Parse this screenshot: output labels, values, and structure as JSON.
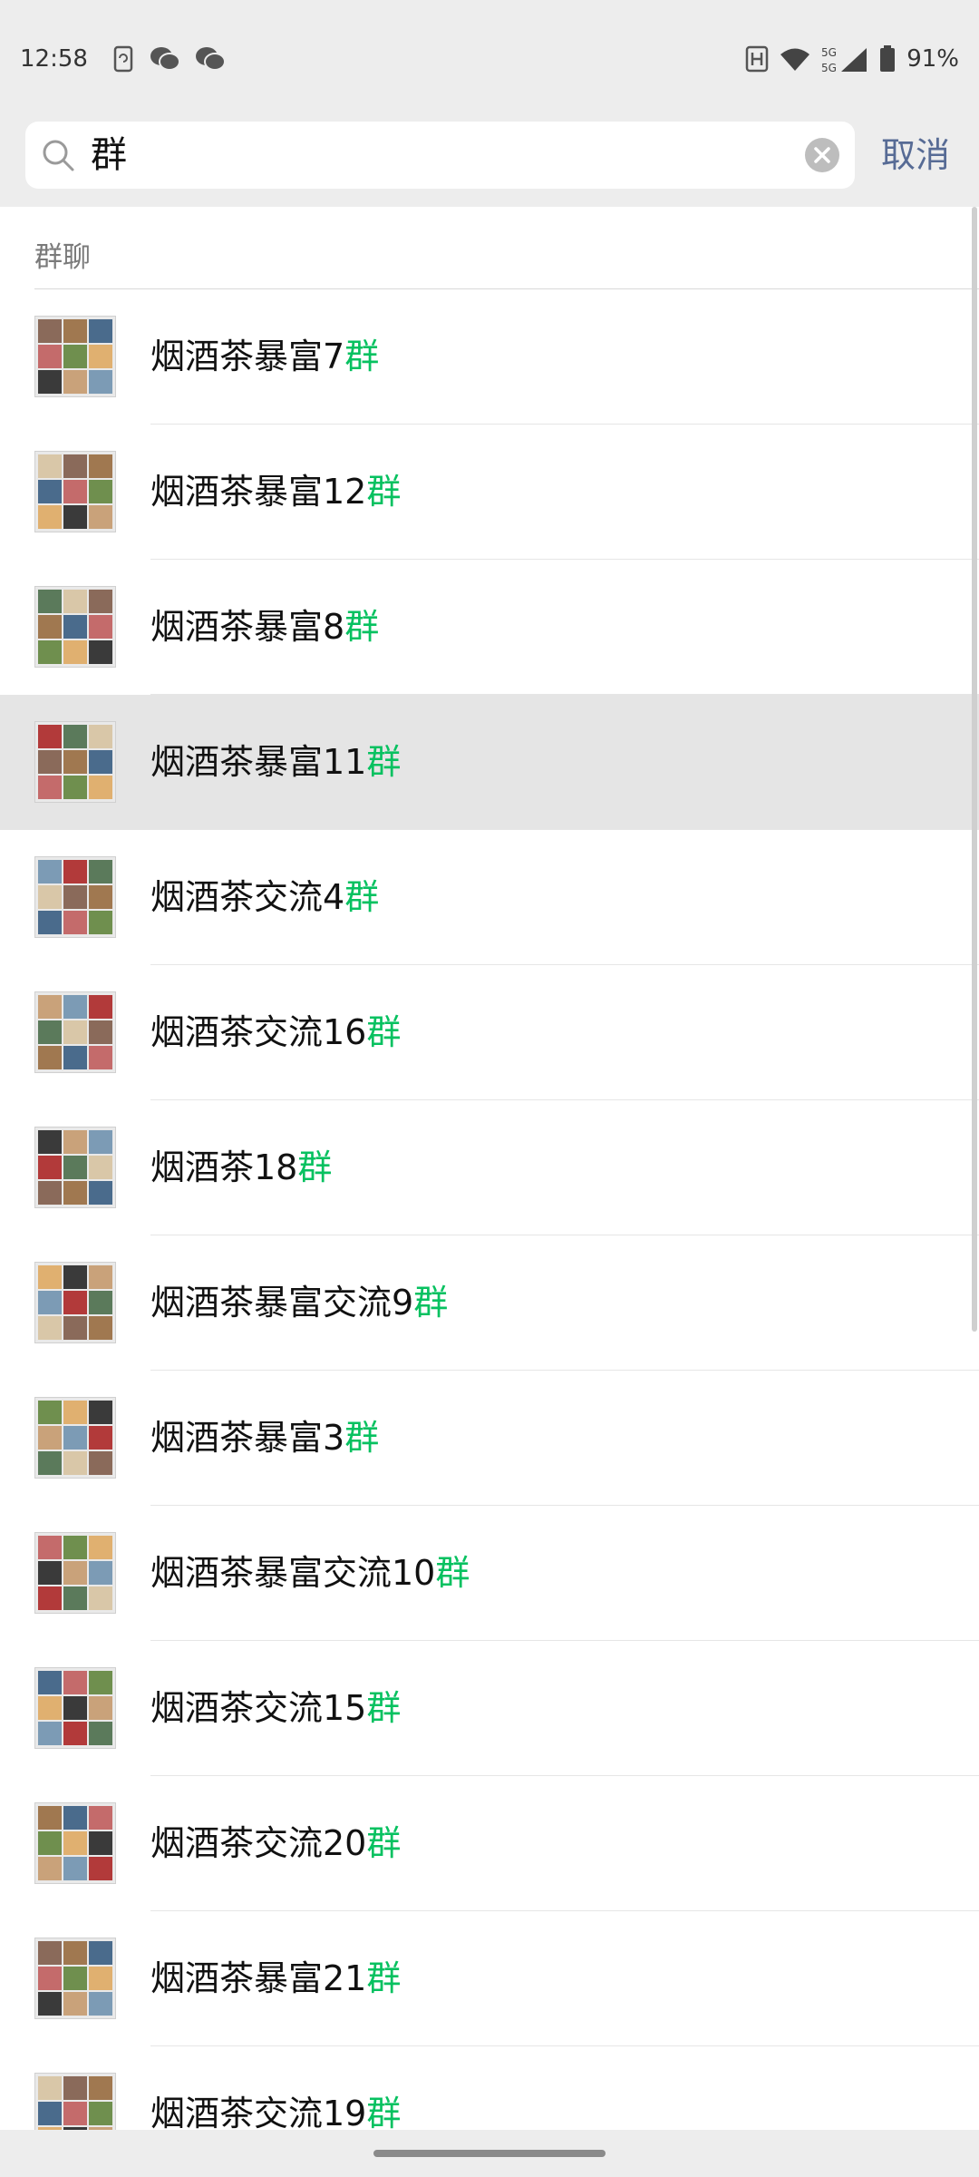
{
  "status_bar": {
    "time": "12:58",
    "left_icons": [
      "phone-sync-icon",
      "wechat-icon",
      "wechat-icon"
    ],
    "right_icons": [
      "nfc-icon",
      "wifi-icon",
      "5g-signal-icon",
      "battery-icon"
    ],
    "battery_percent": "91%"
  },
  "search": {
    "query": "群",
    "cancel_label": "取消"
  },
  "section": {
    "title": "群聊"
  },
  "colors": {
    "highlight_text": "#07c160",
    "cancel_text": "#576b95",
    "selected_row": "#e5e5e5"
  },
  "groups": [
    {
      "name": "烟酒茶暴富7",
      "match": "群"
    },
    {
      "name": "烟酒茶暴富12",
      "match": "群"
    },
    {
      "name": "烟酒茶暴富8",
      "match": "群"
    },
    {
      "name": "烟酒茶暴富11",
      "match": "群",
      "selected": true
    },
    {
      "name": "烟酒茶交流4",
      "match": "群"
    },
    {
      "name": "烟酒茶交流16",
      "match": "群"
    },
    {
      "name": "烟酒茶18",
      "match": "群"
    },
    {
      "name": "烟酒茶暴富交流9",
      "match": "群"
    },
    {
      "name": "烟酒茶暴富3",
      "match": "群"
    },
    {
      "name": "烟酒茶暴富交流10",
      "match": "群"
    },
    {
      "name": "烟酒茶交流15",
      "match": "群"
    },
    {
      "name": "烟酒茶交流20",
      "match": "群"
    },
    {
      "name": "烟酒茶暴富21",
      "match": "群"
    },
    {
      "name": "烟酒茶交流19",
      "match": "群"
    }
  ]
}
